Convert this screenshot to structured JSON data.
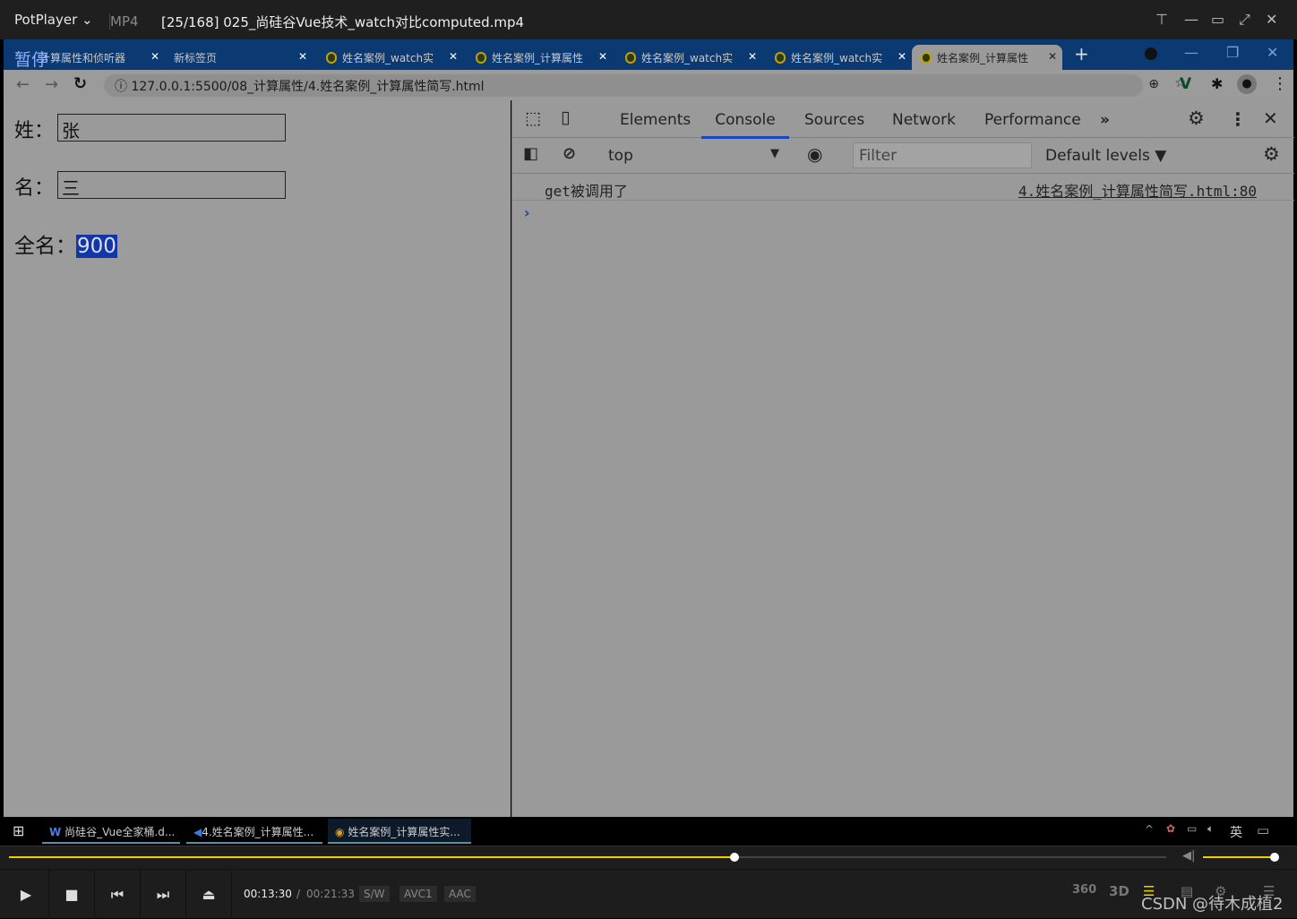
{
  "player": {
    "app": "PotPlayer",
    "format": "MP4",
    "title": "[25/168] 025_尚硅谷Vue技术_watch对比computed.mp4",
    "pause_overlay": "暂停",
    "time_current": "00:13:30",
    "time_sep": "/",
    "time_total": "00:21:33",
    "badges": [
      "S/W",
      "AVC1",
      "AAC"
    ],
    "progress": 0.627,
    "volume": 1.0,
    "right_icons": [
      "360",
      "3D"
    ],
    "watermark": "CSDN @待木成植2",
    "accent": "#f0d000"
  },
  "browser": {
    "tabs": [
      {
        "label": "计算属性和侦听器"
      },
      {
        "label": "新标签页"
      },
      {
        "label": "姓名案例_watch实"
      },
      {
        "label": "姓名案例_计算属性"
      },
      {
        "label": "姓名案例_watch实"
      },
      {
        "label": "姓名案例_watch实"
      },
      {
        "label": "姓名案例_计算属性",
        "active": true
      }
    ],
    "url": "127.0.0.1:5500/08_计算属性/4.姓名案例_计算属性简写.html"
  },
  "page": {
    "last_label": "姓：",
    "last_value": "张",
    "first_label": "名：",
    "first_value": "三",
    "full_label": "全名：",
    "full_value": "900"
  },
  "devtools": {
    "tabs": [
      "Elements",
      "Console",
      "Sources",
      "Network",
      "Performance"
    ],
    "active_tab": "Console",
    "context": "top",
    "filter_placeholder": "Filter",
    "levels": "Default levels ▼",
    "messages": [
      {
        "text": "get被调用了",
        "source": "4.姓名案例_计算属性简写.html:80"
      }
    ]
  },
  "taskbar": {
    "items": [
      "尚硅谷_Vue全家桶.d...",
      "4.姓名案例_计算属性...",
      "姓名案例_计算属性实..."
    ],
    "ime": "英"
  }
}
